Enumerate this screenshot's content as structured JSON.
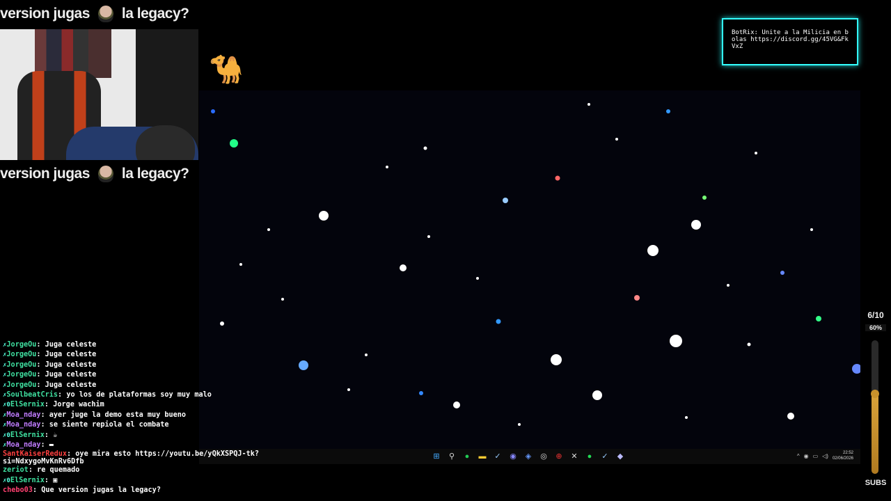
{
  "overlay_banner": {
    "left_text": "version jugas",
    "right_text": "la legacy?"
  },
  "botrix_alert": {
    "text": "BotRix: Unite a la Milicia en bolas https://discord.gg/45VG&FkVxZ"
  },
  "subs_goal": {
    "count": "6/10",
    "percent": "60%",
    "level": 0.6,
    "label": "SUBS",
    "accent": "#d9a33a"
  },
  "taskbar": {
    "icons": [
      "windows-icon",
      "search-icon",
      "whatsapp-icon",
      "files-icon",
      "steam-icon",
      "discord-icon",
      "app-icon",
      "chrome-icon",
      "obs-icon",
      "capcut-icon",
      "spotify-icon",
      "steam-icon-2",
      "app-icon-2"
    ],
    "clock_time": "22:52",
    "clock_date": "02/06/2026"
  },
  "chat": [
    {
      "user": "JorgeOu",
      "text": "Juga celeste",
      "user_color": "#3fe0a0"
    },
    {
      "user": "JorgeOu",
      "text": "Juga celeste",
      "user_color": "#3fe0a0"
    },
    {
      "user": "JorgeOu",
      "text": "Juga celeste",
      "user_color": "#3fe0a0"
    },
    {
      "user": "JorgeOu",
      "text": "Juga celeste",
      "user_color": "#3fe0a0"
    },
    {
      "user": "JorgeOu",
      "text": "Juga celeste",
      "user_color": "#3fe0a0"
    },
    {
      "user": "SoulbeatCris",
      "text": "yo los de plataformas soy muy malo",
      "user_color": "#3fe0a0"
    },
    {
      "user": "ElSernix",
      "text": "Jorge wachim",
      "user_color": "#3fe0a0",
      "badge": "✗0"
    },
    {
      "user": "Moa_nday",
      "text": "ayer juge la demo esta muy bueno",
      "user_color": "#c07cff"
    },
    {
      "user": "Moa_nday",
      "text": "se siente repiola el combate",
      "user_color": "#c07cff"
    },
    {
      "user": "ElSernix",
      "text": "",
      "user_color": "#3fe0a0",
      "badge": "✗0"
    },
    {
      "user": "Moa_nday",
      "text": "",
      "user_color": "#c07cff"
    },
    {
      "user": "SantKaiserRedux",
      "text": "oye mira esto https://youtu.be/yQkXSPQJ-tk?si=NdxygoMvKnRv6Dfb",
      "user_color": "#ff4040"
    },
    {
      "user": "zeriot",
      "text": "re quemado",
      "user_color": "#3fe0a0"
    },
    {
      "user": "ElSernix",
      "text": "",
      "user_color": "#3fe0a0",
      "badge": "✗0"
    },
    {
      "user": "chebo03",
      "text": "Que version jugas la legacy?",
      "user_color": "#ff4070"
    }
  ]
}
